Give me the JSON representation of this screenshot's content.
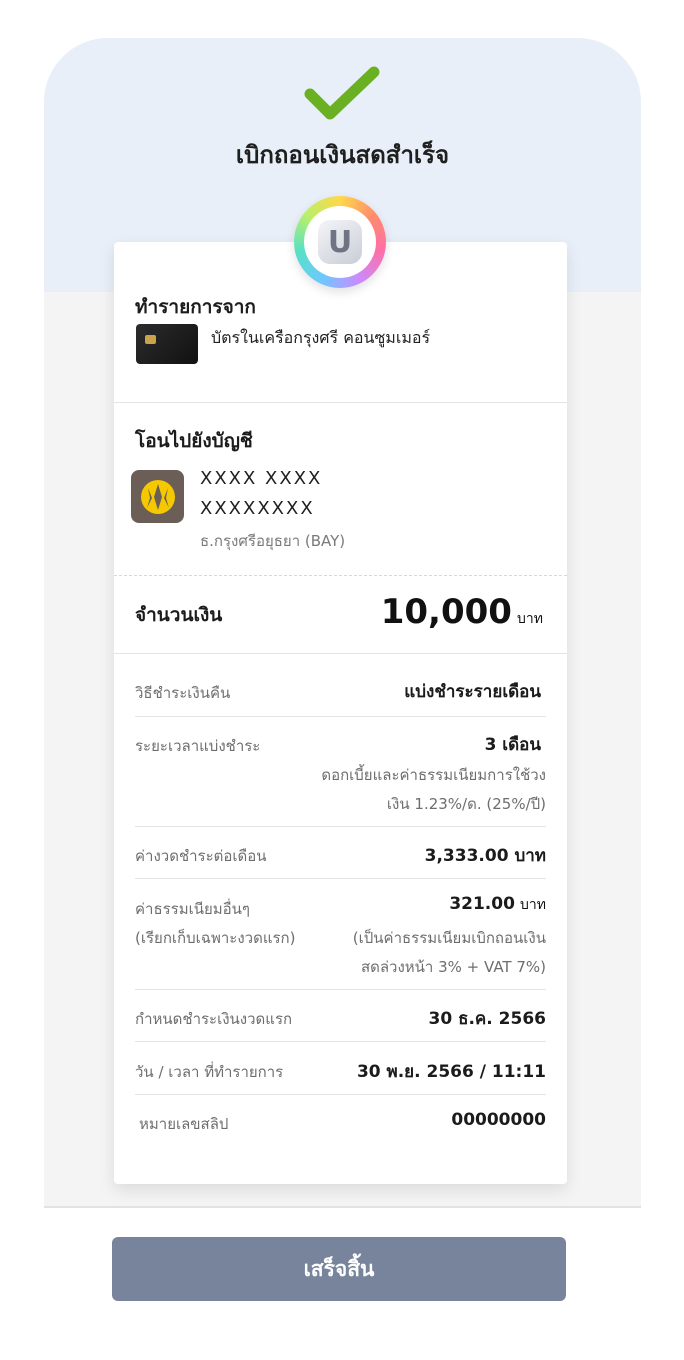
{
  "header": {
    "title": "เบิกถอนเงินสดสำเร็จ",
    "logo_letter": "U"
  },
  "from_section": {
    "title": "ทำรายการจาก",
    "card_name": "บัตรในเครือกรุงศรี คอนซูมเมอร์"
  },
  "to_section": {
    "title": "โอนไปยังบัญชี",
    "account_name": "XXXX XXXX",
    "account_number": "XXXXXXXX",
    "bank_name": "ธ.กรุงศรีอยุธยา (BAY)"
  },
  "amount": {
    "label": "จำนวนเงิน",
    "value": "10,000",
    "unit": "บาท"
  },
  "details": {
    "repayment_method_label": "วิธีชำระเงินคืน",
    "repayment_method_value": "แบ่งชำระรายเดือน",
    "installment_period_label": "ระยะเวลาแบ่งชำระ",
    "installment_period_value": "3 เดือน",
    "interest_line1": "ดอกเบี้ยและค่าธรรมเนียมการใช้วง",
    "interest_line2": "เงิน 1.23%/ด. (25%/ปี)",
    "monthly_payment_label": "ค่างวดชำระต่อเดือน",
    "monthly_payment_value": "3,333.00 บาท",
    "other_fees_label_1": "ค่าธรรมเนียมอื่นๆ",
    "other_fees_label_2": "(เรียกเก็บเฉพาะงวดแรก)",
    "other_fees_value": "321.00",
    "other_fees_unit": "บาท",
    "other_fees_note_1": "(เป็นค่าธรรมเนียมเบิกถอนเงิน",
    "other_fees_note_2": "สดล่วงหน้า 3% + VAT 7%)",
    "first_due_label": "กำหนดชำระเงินงวดแรก",
    "first_due_value": "30 ธ.ค. 2566",
    "datetime_label": "วัน / เวลา ที่ทำรายการ",
    "datetime_value": "30 พ.ย. 2566 / 11:11",
    "slip_label": "หมายเลขสลิป",
    "slip_value": "00000000"
  },
  "button": {
    "done_label": "เสร็จสิ้น"
  },
  "colors": {
    "header_bg": "#e9eff8",
    "check": "#6ab023",
    "button_bg": "#77849b",
    "bank_icon_bg": "#6b5e57",
    "bank_icon_fg": "#f6c800"
  }
}
